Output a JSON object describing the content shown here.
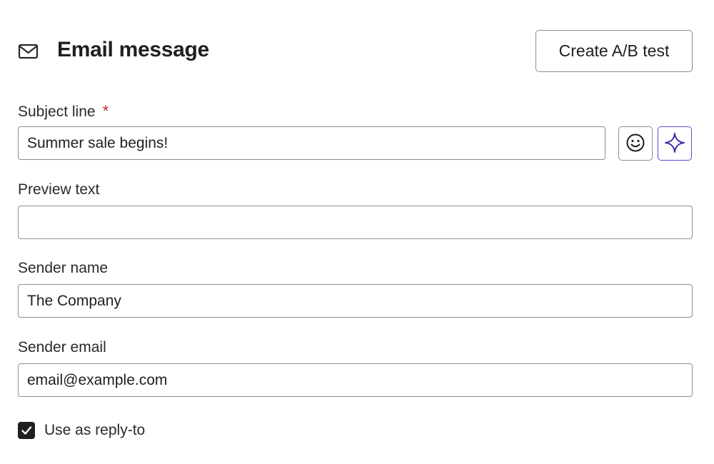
{
  "header": {
    "icon": "mail-icon",
    "title": "Email message",
    "ab_test_label": "Create A/B test"
  },
  "subject": {
    "label": "Subject line",
    "required_marker": "*",
    "value": "Summer sale begins!",
    "emoji_icon": "smiley-icon",
    "ai_icon": "sparkle-icon"
  },
  "preview": {
    "label": "Preview text",
    "value": ""
  },
  "sender_name": {
    "label": "Sender name",
    "value": "The Company"
  },
  "sender_email": {
    "label": "Sender email",
    "value": "email@example.com"
  },
  "reply_to": {
    "label": "Use as reply-to",
    "checked": true
  },
  "colors": {
    "required": "#c2262e",
    "ai_accent": "#5b4fd1",
    "checkbox": "#1f1f22"
  }
}
